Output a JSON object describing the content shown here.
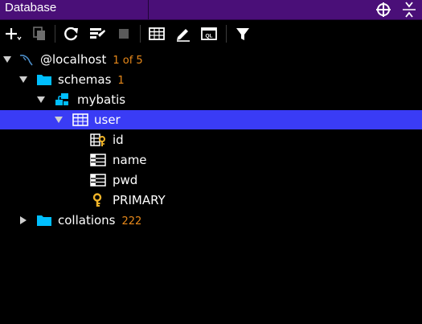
{
  "window": {
    "title": "Database"
  },
  "toolbar": {
    "icons": [
      "add-icon",
      "copy-icon",
      "refresh-icon",
      "schema-sync-icon",
      "stop-icon",
      "table-view-icon",
      "edit-icon",
      "console-icon",
      "filter-icon"
    ]
  },
  "tree": {
    "datasource": {
      "label": "@localhost",
      "count": "1 of 5"
    },
    "schemas": {
      "label": "schemas",
      "count": "1"
    },
    "schema": {
      "label": "mybatis"
    },
    "table": {
      "label": "user"
    },
    "columns": [
      {
        "label": "id"
      },
      {
        "label": "name"
      },
      {
        "label": "pwd"
      }
    ],
    "key": {
      "label": "PRIMARY"
    },
    "collations": {
      "label": "collations",
      "count": "222"
    }
  },
  "colors": {
    "titlebar": "#4a0f78",
    "selection": "#3a3cf5",
    "folder": "#00bfff",
    "count": "#e8891a",
    "key": "#f0b429"
  }
}
